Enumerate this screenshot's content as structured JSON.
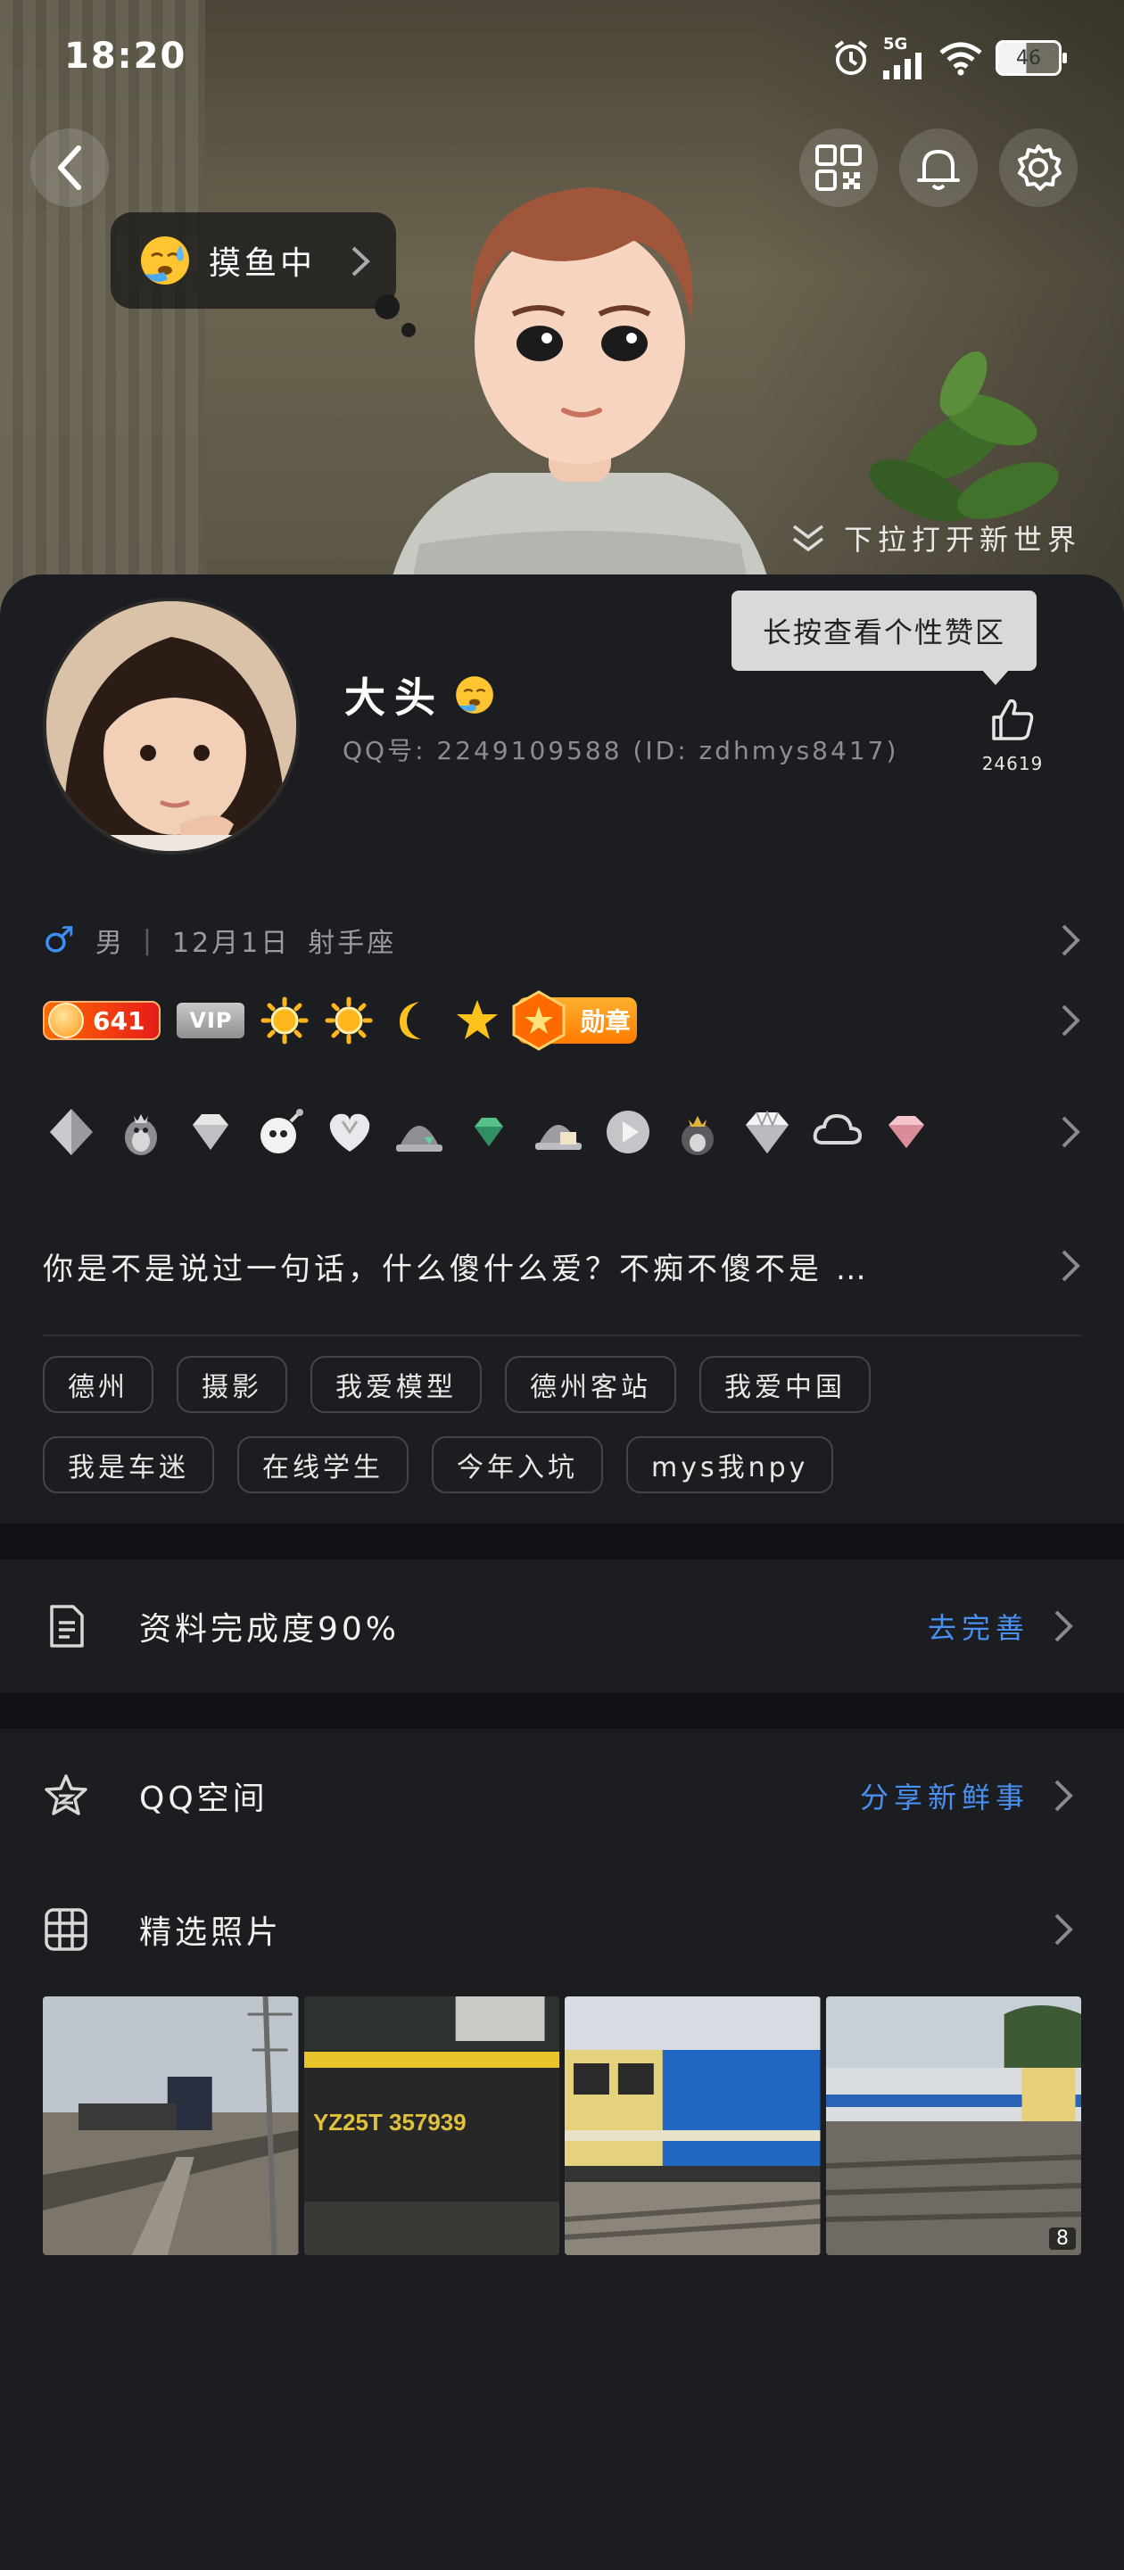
{
  "status_bar": {
    "time": "18:20",
    "network": "5G",
    "battery": "46"
  },
  "hero": {
    "mood_text": "摸鱼中",
    "pull_hint": "下拉打开新世界"
  },
  "profile": {
    "name": "大头",
    "qq_line": "QQ号: 2249109588 (ID: zdhmys8417)",
    "tooltip": "长按查看个性赞区",
    "like_count": "24619",
    "gender_symbol": "♂",
    "gender": "男",
    "birthday": "12月1日",
    "zodiac": "射手座",
    "level": "641",
    "vip_label": "VIP",
    "medal_label": "勋章",
    "signature": "你是不是说过一句话，什么傻什么爱？不痴不傻不是 …",
    "tags": [
      "德州",
      "摄影",
      "我爱模型",
      "德州客站",
      "我爱中国",
      "我是车迷",
      "在线学生",
      "今年入坑",
      "mys我npy"
    ]
  },
  "completion": {
    "label": "资料完成度90%",
    "action": "去完善"
  },
  "qzone": {
    "label": "QQ空间",
    "action": "分享新鲜事"
  },
  "photos": {
    "label": "精选照片",
    "train_number": "YZ25T 357939",
    "count_badge": "8"
  },
  "colors": {
    "accent_blue": "#4a90f0",
    "background": "#1c1d20",
    "level_badge": "#e51b1b",
    "medal": "#ff8a00"
  }
}
